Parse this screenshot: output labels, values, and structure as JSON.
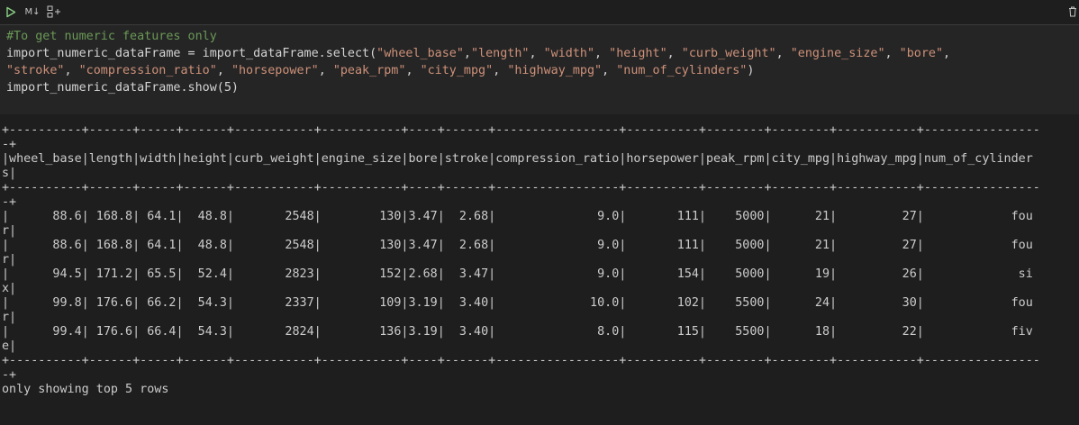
{
  "toolbar": {
    "run_icon": "play-icon",
    "markdown_label": "M↓",
    "split_icon": "split-cell-icon",
    "delete_icon": "trash-icon"
  },
  "cell": {
    "code_lines": [
      "#To get numeric features only",
      "import_numeric_dataFrame = import_dataFrame.select(\"wheel_base\",\"length\", \"width\", \"height\", \"curb_weight\", \"engine_size\", \"bore\",",
      "\"stroke\", \"compression_ratio\", \"horsepower\", \"peak_rpm\", \"city_mpg\", \"highway_mpg\", \"num_of_cylinders\")",
      "import_numeric_dataFrame.show(5)"
    ]
  },
  "output": {
    "lines": [
      "+----------+------+-----+------+-----------+-----------+----+------+-----------------+----------+--------+--------+-----------+----------------",
      "-+",
      "|wheel_base|length|width|height|curb_weight|engine_size|bore|stroke|compression_ratio|horsepower|peak_rpm|city_mpg|highway_mpg|num_of_cylinder",
      "s|",
      "+----------+------+-----+------+-----------+-----------+----+------+-----------------+----------+--------+--------+-----------+----------------",
      "-+",
      "|      88.6| 168.8| 64.1|  48.8|       2548|        130|3.47|  2.68|              9.0|       111|    5000|      21|         27|            fou",
      "r|",
      "|      88.6| 168.8| 64.1|  48.8|       2548|        130|3.47|  2.68|              9.0|       111|    5000|      21|         27|            fou",
      "r|",
      "|      94.5| 171.2| 65.5|  52.4|       2823|        152|2.68|  3.47|              9.0|       154|    5000|      19|         26|             si",
      "x|",
      "|      99.8| 176.6| 66.2|  54.3|       2337|        109|3.19|  3.40|             10.0|       102|    5500|      24|         30|            fou",
      "r|",
      "|      99.4| 176.6| 66.4|  54.3|       2824|        136|3.19|  3.40|              8.0|       115|    5500|      18|         22|            fiv",
      "e|",
      "+----------+------+-----+------+-----------+-----------+----+------+-----------------+----------+--------+--------+-----------+----------------",
      "-+",
      "only showing top 5 rows"
    ]
  }
}
